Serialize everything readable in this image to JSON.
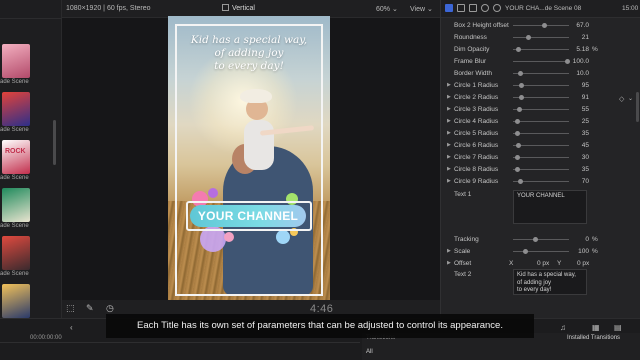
{
  "browser": {
    "items": [
      {
        "label": "ade Scene",
        "colors": [
          "#f3b0c0",
          "#b24a6a"
        ]
      },
      {
        "label": "ade Scene",
        "colors": [
          "#e3433a",
          "#2d2f8a"
        ]
      },
      {
        "label": "ade Scene",
        "colors": [
          "#ffffff",
          "#c22e4c"
        ]
      },
      {
        "label": "ade Scene",
        "colors": [
          "#1f8a5c",
          "#e9e4d0"
        ]
      },
      {
        "label": "ade Scene",
        "colors": [
          "#e04a3f",
          "#3a2a2e"
        ]
      },
      {
        "label": "ade Scene",
        "colors": [
          "#f2c25a",
          "#2a3a6a"
        ]
      }
    ],
    "thumb_texts": [
      "",
      "",
      "ROCK",
      "",
      "",
      ""
    ]
  },
  "viewer": {
    "format_info": "1080×1920 | 60 fps, Stereo",
    "title": "Vertical",
    "zoom": "60%",
    "view_label": "View",
    "timecode": "4:46",
    "video": {
      "headline": "Kid has a special way,\nof adding joy\nto every day!",
      "channel": "YOUR CHANNEL"
    }
  },
  "inspector": {
    "clip_name": "YOUR CHA...de Scene 08",
    "clip_time": "15:00",
    "params": [
      {
        "label": "Box 2 Height offset",
        "value": "67.0",
        "unit": "",
        "expandable": false,
        "knob": 0.55
      },
      {
        "label": "Roundness",
        "value": "21",
        "unit": "",
        "expandable": false,
        "knob": 0.25
      },
      {
        "label": "Dim Opacity",
        "value": "5.18",
        "unit": "%",
        "expandable": false,
        "knob": 0.05
      },
      {
        "label": "Frame Blur",
        "value": "100.0",
        "unit": "",
        "expandable": false,
        "knob": 1.0
      },
      {
        "label": "Border Width",
        "value": "10.0",
        "unit": "",
        "expandable": false,
        "knob": 0.1
      },
      {
        "label": "Circle 1 Radius",
        "value": "95",
        "unit": "",
        "expandable": true,
        "knob": 0.12
      },
      {
        "label": "Circle 2 Radius",
        "value": "91",
        "unit": "",
        "expandable": true,
        "knob": 0.11
      },
      {
        "label": "Circle 3 Radius",
        "value": "55",
        "unit": "",
        "expandable": true,
        "knob": 0.07
      },
      {
        "label": "Circle 4 Radius",
        "value": "25",
        "unit": "",
        "expandable": true,
        "knob": 0.03
      },
      {
        "label": "Circle 5 Radius",
        "value": "35",
        "unit": "",
        "expandable": true,
        "knob": 0.04
      },
      {
        "label": "Circle 6 Radius",
        "value": "45",
        "unit": "",
        "expandable": true,
        "knob": 0.05
      },
      {
        "label": "Circle 7 Radius",
        "value": "30",
        "unit": "",
        "expandable": true,
        "knob": 0.03
      },
      {
        "label": "Circle 8 Radius",
        "value": "35",
        "unit": "",
        "expandable": true,
        "knob": 0.04
      },
      {
        "label": "Circle 9 Radius",
        "value": "70",
        "unit": "",
        "expandable": true,
        "knob": 0.09
      }
    ],
    "text1_label": "Text 1",
    "text1_value": "YOUR CHANNEL",
    "tracking": {
      "label": "Tracking",
      "value": "0",
      "unit": "%",
      "knob": 0.4
    },
    "scale": {
      "label": "Scale",
      "value": "100",
      "unit": "%",
      "knob": 0.25
    },
    "offset": {
      "label": "Offset",
      "x_label": "X",
      "x_value": "0 px",
      "y_label": "Y",
      "y_value": "0 px"
    },
    "text2_label": "Text 2",
    "text2_value": "Kid has a special way,\nof adding joy\nto every day!"
  },
  "timeline": {
    "timecode": "00:00:00:00",
    "transitions_label": "Transitions",
    "installed_transitions": "Installed Transitions",
    "all_label": "All"
  },
  "caption": "Each Title has its own set of parameters that can be adjusted to control its appearance."
}
